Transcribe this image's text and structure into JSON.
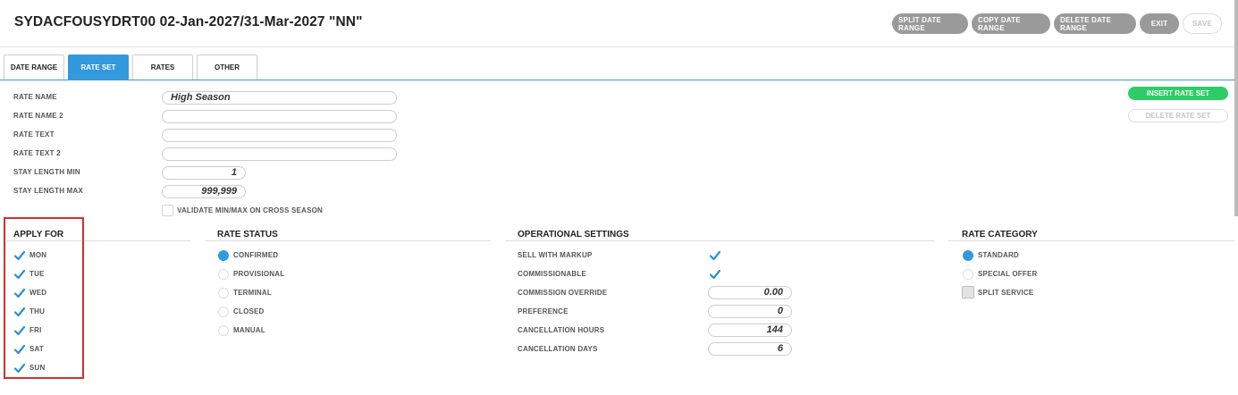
{
  "header": {
    "title": "SYDACFOUSYDRT00 02-Jan-2027/31-Mar-2027 \"NN\"",
    "actions": [
      "SPLIT DATE RANGE",
      "COPY DATE RANGE",
      "DELETE DATE RANGE",
      "EXIT",
      "SAVE"
    ]
  },
  "tabs": [
    "DATE RANGE",
    "RATE SET",
    "RATES",
    "OTHER"
  ],
  "active_tab": "RATE SET",
  "form": {
    "rate_name_label": "RATE NAME",
    "rate_name_value": "High Season",
    "rate_name_2_label": "RATE NAME 2",
    "rate_name_2_value": "",
    "rate_text_label": "RATE TEXT",
    "rate_text_value": "",
    "rate_text_2_label": "RATE TEXT 2",
    "rate_text_2_value": "",
    "stay_min_label": "STAY LENGTH MIN",
    "stay_min_value": "1",
    "stay_max_label": "STAY LENGTH MAX",
    "stay_max_value": "999,999",
    "validate_label": "VALIDATE MIN/MAX ON CROSS SEASON",
    "validate_checked": false
  },
  "side_buttons": {
    "insert": "INSERT RATE SET",
    "delete": "DELETE RATE SET"
  },
  "apply_for": {
    "heading": "APPLY FOR",
    "days": [
      {
        "label": "MON",
        "checked": true
      },
      {
        "label": "TUE",
        "checked": true
      },
      {
        "label": "WED",
        "checked": true
      },
      {
        "label": "THU",
        "checked": true
      },
      {
        "label": "FRI",
        "checked": true
      },
      {
        "label": "SAT",
        "checked": true
      },
      {
        "label": "SUN",
        "checked": true
      }
    ]
  },
  "rate_status": {
    "heading": "RATE STATUS",
    "options": [
      {
        "label": "CONFIRMED",
        "selected": true
      },
      {
        "label": "PROVISIONAL",
        "selected": false
      },
      {
        "label": "TERMINAL",
        "selected": false
      },
      {
        "label": "CLOSED",
        "selected": false
      },
      {
        "label": "MANUAL",
        "selected": false
      }
    ]
  },
  "operational": {
    "heading": "OPERATIONAL SETTINGS",
    "sell_with_markup_label": "SELL WITH MARKUP",
    "sell_with_markup": true,
    "commissionable_label": "COMMISSIONABLE",
    "commissionable": true,
    "commission_override_label": "COMMISSION OVERRIDE",
    "commission_override": "0.00",
    "preference_label": "PREFERENCE",
    "preference": "0",
    "cancellation_hours_label": "CANCELLATION HOURS",
    "cancellation_hours": "144",
    "cancellation_days_label": "CANCELLATION DAYS",
    "cancellation_days": "6"
  },
  "rate_category": {
    "heading": "RATE CATEGORY",
    "standard_label": "STANDARD",
    "standard_selected": true,
    "special_offer_label": "SPECIAL OFFER",
    "special_offer_selected": false,
    "split_service_label": "SPLIT SERVICE",
    "split_service_checked": false
  },
  "colors": {
    "accent": "#3399dd",
    "green": "#2ecc66",
    "pill_gray": "#9a9a9a",
    "highlight_red": "#d32f2f"
  }
}
